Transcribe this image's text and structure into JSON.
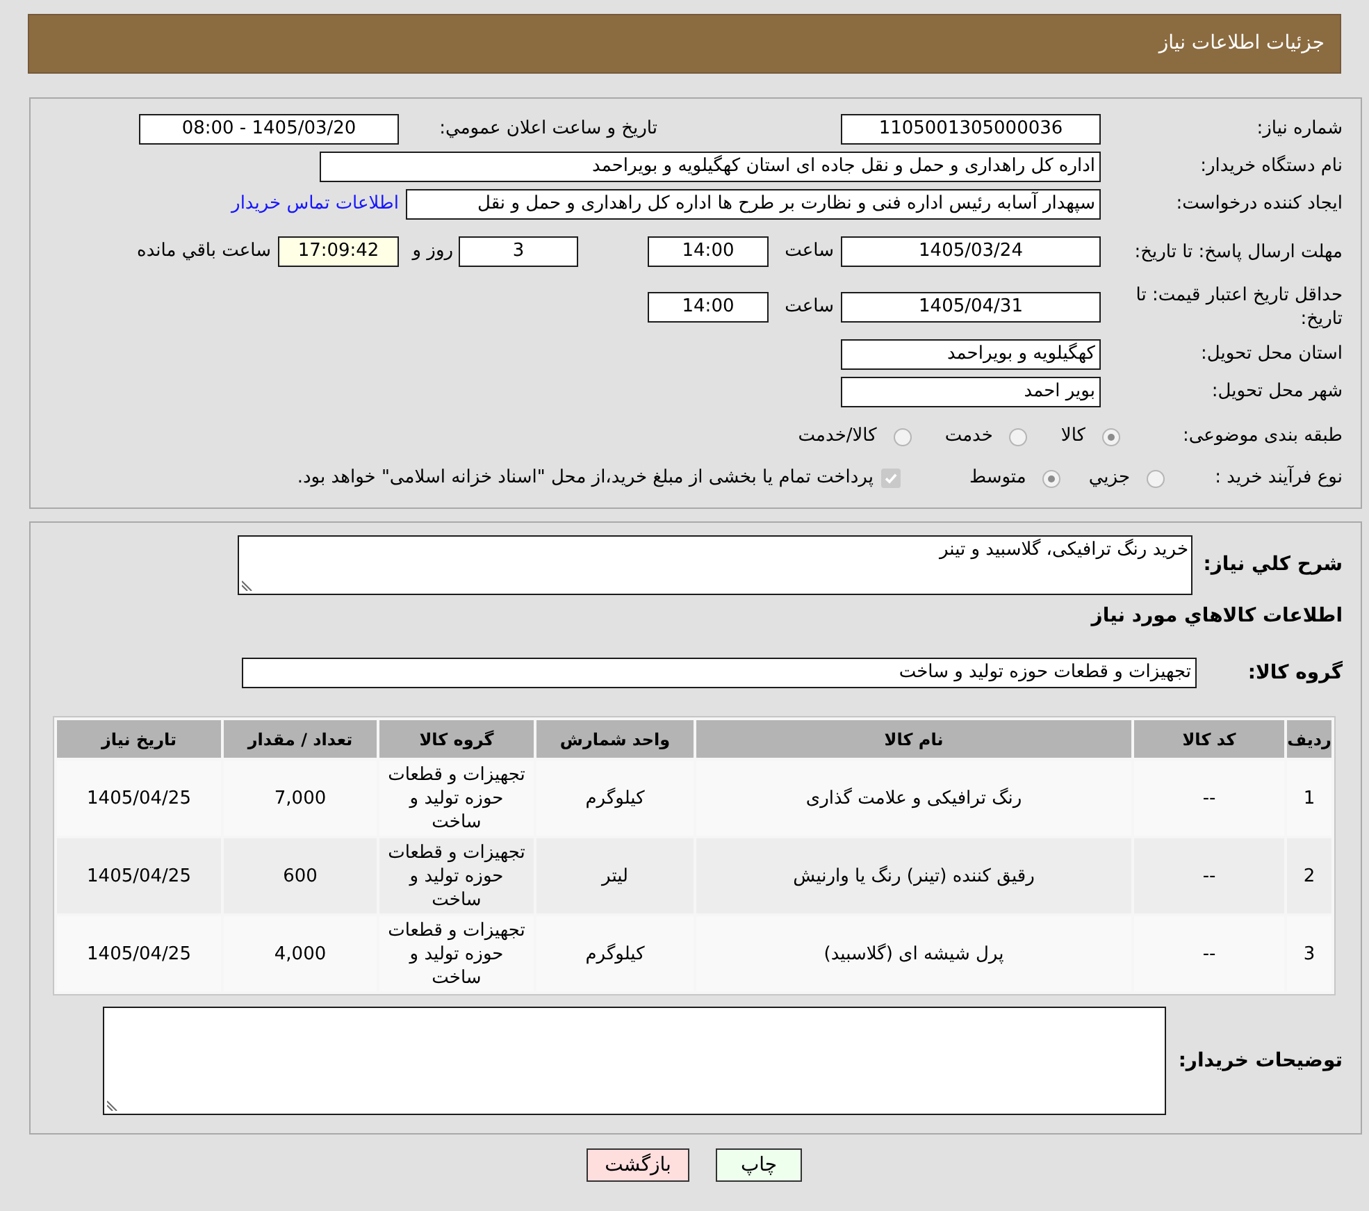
{
  "header": {
    "title": "جزئیات اطلاعات نیاز"
  },
  "details": {
    "need_number": {
      "label": "شماره نیاز:",
      "value": "1105001305000036"
    },
    "announcement": {
      "label": "تاريخ و ساعت اعلان عمومي:",
      "value": "1405/03/20 - 08:00"
    },
    "buyer_org": {
      "label": "نام دستگاه خریدار:",
      "value": "اداره کل راهداری و حمل و نقل جاده ای استان کهگیلویه و بویراحمد"
    },
    "requester": {
      "label": "ایجاد کننده درخواست:",
      "value": "سپهدار آسابه رئیس اداره فنی و نظارت بر طرح ها اداره کل راهداری و حمل و نقل",
      "link": "اطلاعات تماس خریدار"
    },
    "response_deadline": {
      "label": "مهلت ارسال پاسخ: تا تاریخ:",
      "date": "1405/03/24",
      "time_label": "ساعت",
      "time": "14:00",
      "days": "3",
      "days_label": "روز و",
      "remaining": "17:09:42",
      "remaining_label": "ساعت باقي مانده"
    },
    "price_validity": {
      "label": "حداقل تاریخ اعتبار قیمت: تا تاریخ:",
      "date": "1405/04/31",
      "time_label": "ساعت",
      "time": "14:00"
    },
    "delivery_province": {
      "label": "استان محل تحویل:",
      "value": "کهگیلویه و بویراحمد"
    },
    "delivery_city": {
      "label": "شهر محل تحویل:",
      "value": "بویر احمد"
    },
    "category": {
      "label": "طبقه بندی موضوعی:",
      "options": [
        {
          "label": "کالا",
          "selected": true
        },
        {
          "label": "خدمت",
          "selected": false
        },
        {
          "label": "کالا/خدمت",
          "selected": false
        }
      ]
    },
    "purchase_process": {
      "label": "نوع فرآیند خرید :",
      "options": [
        {
          "label": "جزيي",
          "selected": false
        },
        {
          "label": "متوسط",
          "selected": true
        }
      ],
      "treasury_payment": {
        "label": "پرداخت تمام یا بخشی از مبلغ خرید،از محل \"اسناد خزانه اسلامی\" خواهد بود.",
        "checked": true
      }
    }
  },
  "description": {
    "label": "شرح کلي نياز:",
    "value": "خرید رنگ ترافیکی، گلاسبید و تینر"
  },
  "goods_section": {
    "title": "اطلاعات کالاهاي مورد نياز"
  },
  "goods_group": {
    "label": "گروه کالا:",
    "value": "تجهیزات و قطعات حوزه تولید و ساخت"
  },
  "goods_table": {
    "columns": [
      "ردیف",
      "کد کالا",
      "نام کالا",
      "واحد شمارش",
      "گروه کالا",
      "تعداد / مقدار",
      "تاریخ نیاز"
    ],
    "rows": [
      [
        "1",
        "--",
        "رنگ ترافیکی و علامت گذاری",
        "کیلوگرم",
        "تجهیزات و قطعات حوزه تولید و ساخت",
        "7,000",
        "1405/04/25"
      ],
      [
        "2",
        "--",
        "رقیق کننده (تینر) رنگ یا وارنیش",
        "لیتر",
        "تجهیزات و قطعات حوزه تولید و ساخت",
        "600",
        "1405/04/25"
      ],
      [
        "3",
        "--",
        "پرل شیشه ای (گلاسبید)",
        "کیلوگرم",
        "تجهیزات و قطعات حوزه تولید و ساخت",
        "4,000",
        "1405/04/25"
      ]
    ]
  },
  "buyer_notes": {
    "label": "توضیحات خریدار:"
  },
  "buttons": [
    {
      "label": "چاپ",
      "kind": "print"
    },
    {
      "label": "بازگشت",
      "kind": "back"
    }
  ]
}
